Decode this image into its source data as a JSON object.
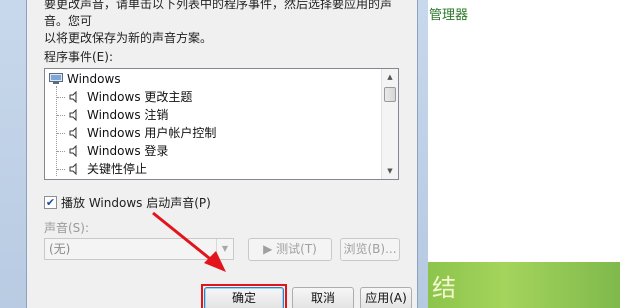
{
  "dialog": {
    "intro_line1": "要更改声音，请单击以下列表中的程序事件，然后选择要应用的声音。您可",
    "intro_line2": "以将更改保存为新的声音方案。",
    "events_label": "程序事件(E):",
    "events": [
      {
        "label": "Windows",
        "type": "group",
        "icon": "computer-icon"
      },
      {
        "label": "Windows 更改主题",
        "type": "item",
        "icon": "speaker-icon"
      },
      {
        "label": "Windows 注销",
        "type": "item",
        "icon": "speaker-icon"
      },
      {
        "label": "Windows 用户帐户控制",
        "type": "item",
        "icon": "speaker-icon"
      },
      {
        "label": "Windows 登录",
        "type": "item",
        "icon": "speaker-icon"
      },
      {
        "label": "关键性停止",
        "type": "item",
        "icon": "speaker-icon"
      }
    ],
    "startup_checkbox": {
      "label": "播放 Windows 启动声音(P)",
      "checked": true
    },
    "sound_label": "声音(S):",
    "sound_value": "(无)",
    "test_button": "▶ 测试(T)",
    "browse_button": "浏览(B)...",
    "ok_button": "确定",
    "cancel_button": "取消",
    "apply_button": "应用(A)"
  },
  "background": {
    "link_text": "管理器",
    "banner_text": "结"
  },
  "colors": {
    "annotation_red": "#e2141c",
    "background_link_green": "#2a7a2a"
  }
}
